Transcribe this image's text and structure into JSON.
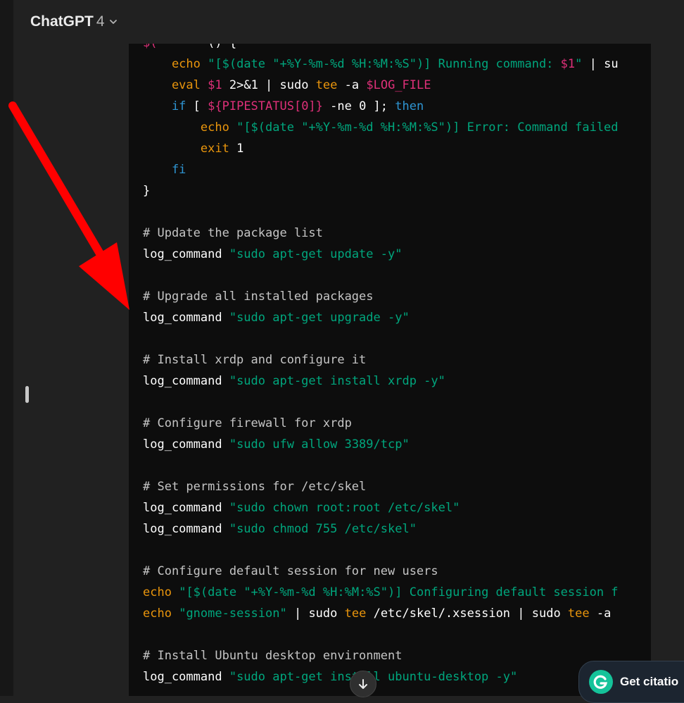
{
  "header": {
    "model_name": "ChatGPT",
    "model_version": "4",
    "dropdown_icon": "chevron-down-icon"
  },
  "code": {
    "lines": [
      [
        {
          "t": "$(",
          "c": "var"
        },
        {
          "t": "       ",
          "c": "plain"
        },
        {
          "t": "()",
          "c": "plain"
        },
        {
          "t": " {",
          "c": "plain"
        }
      ],
      [
        {
          "t": "    echo",
          "c": "builtin"
        },
        {
          "t": " ",
          "c": "plain"
        },
        {
          "t": "\"[$(date \"+%Y-%m-%d %H:%M:%S\")] Running command: ",
          "c": "string"
        },
        {
          "t": "$1",
          "c": "var"
        },
        {
          "t": "\"",
          "c": "string"
        },
        {
          "t": " | su",
          "c": "plain"
        }
      ],
      [
        {
          "t": "    eval",
          "c": "builtin"
        },
        {
          "t": " ",
          "c": "plain"
        },
        {
          "t": "$1",
          "c": "var"
        },
        {
          "t": " 2>&1 | sudo ",
          "c": "plain"
        },
        {
          "t": "tee",
          "c": "builtin"
        },
        {
          "t": " -a ",
          "c": "plain"
        },
        {
          "t": "$LOG_FILE",
          "c": "var"
        }
      ],
      [
        {
          "t": "    if",
          "c": "keyword"
        },
        {
          "t": " [ ",
          "c": "plain"
        },
        {
          "t": "${PIPESTATUS[0]}",
          "c": "var"
        },
        {
          "t": " -ne 0 ]; ",
          "c": "plain"
        },
        {
          "t": "then",
          "c": "keyword"
        }
      ],
      [
        {
          "t": "        echo",
          "c": "builtin"
        },
        {
          "t": " ",
          "c": "plain"
        },
        {
          "t": "\"[$(date \"+%Y-%m-%d %H:%M:%S\")] Error: Command failed",
          "c": "string"
        }
      ],
      [
        {
          "t": "        exit",
          "c": "builtin"
        },
        {
          "t": " 1",
          "c": "plain"
        }
      ],
      [
        {
          "t": "    fi",
          "c": "keyword"
        }
      ],
      [
        {
          "t": "}",
          "c": "plain"
        }
      ],
      [],
      [
        {
          "t": "# Update the package list",
          "c": "comment"
        }
      ],
      [
        {
          "t": "log_command ",
          "c": "plain"
        },
        {
          "t": "\"sudo apt-get update -y\"",
          "c": "string"
        }
      ],
      [],
      [
        {
          "t": "# Upgrade all installed packages",
          "c": "comment"
        }
      ],
      [
        {
          "t": "log_command ",
          "c": "plain"
        },
        {
          "t": "\"sudo apt-get upgrade -y\"",
          "c": "string"
        }
      ],
      [],
      [
        {
          "t": "# Install xrdp and configure it",
          "c": "comment"
        }
      ],
      [
        {
          "t": "log_command ",
          "c": "plain"
        },
        {
          "t": "\"sudo apt-get install xrdp -y\"",
          "c": "string"
        }
      ],
      [],
      [
        {
          "t": "# Configure firewall for xrdp",
          "c": "comment"
        }
      ],
      [
        {
          "t": "log_command ",
          "c": "plain"
        },
        {
          "t": "\"sudo ufw allow 3389/tcp\"",
          "c": "string"
        }
      ],
      [],
      [
        {
          "t": "# Set permissions for /etc/skel",
          "c": "comment"
        }
      ],
      [
        {
          "t": "log_command ",
          "c": "plain"
        },
        {
          "t": "\"sudo chown root:root /etc/skel\"",
          "c": "string"
        }
      ],
      [
        {
          "t": "log_command ",
          "c": "plain"
        },
        {
          "t": "\"sudo chmod 755 /etc/skel\"",
          "c": "string"
        }
      ],
      [],
      [
        {
          "t": "# Configure default session for new users",
          "c": "comment"
        }
      ],
      [
        {
          "t": "echo",
          "c": "builtin"
        },
        {
          "t": " ",
          "c": "plain"
        },
        {
          "t": "\"[$(date \"+%Y-%m-%d %H:%M:%S\")] Configuring default session f",
          "c": "string"
        }
      ],
      [
        {
          "t": "echo",
          "c": "builtin"
        },
        {
          "t": " ",
          "c": "plain"
        },
        {
          "t": "\"gnome-session\"",
          "c": "string"
        },
        {
          "t": " | sudo ",
          "c": "plain"
        },
        {
          "t": "tee",
          "c": "builtin"
        },
        {
          "t": " /etc/skel/.xsession | sudo ",
          "c": "plain"
        },
        {
          "t": "tee",
          "c": "builtin"
        },
        {
          "t": " -a",
          "c": "plain"
        }
      ],
      [],
      [
        {
          "t": "# Install Ubuntu desktop environment",
          "c": "comment"
        }
      ],
      [
        {
          "t": "log_command ",
          "c": "plain"
        },
        {
          "t": "\"sudo apt-get install ubuntu-desktop -y\"",
          "c": "string"
        }
      ]
    ]
  },
  "colors": {
    "background": "#212121",
    "code_background": "#0d0d0d",
    "comment": "#c5c5c5",
    "string": "#00a67d",
    "builtin": "#e9950c",
    "variable": "#df3079",
    "keyword": "#2e95d3",
    "annotation_arrow": "#ff0000"
  },
  "annotation": {
    "arrow_icon": "red-arrow-icon"
  },
  "scroll_button": {
    "icon": "arrow-down-icon"
  },
  "grammarly": {
    "logo_icon": "grammarly-g-icon",
    "label": "Get citatio"
  }
}
